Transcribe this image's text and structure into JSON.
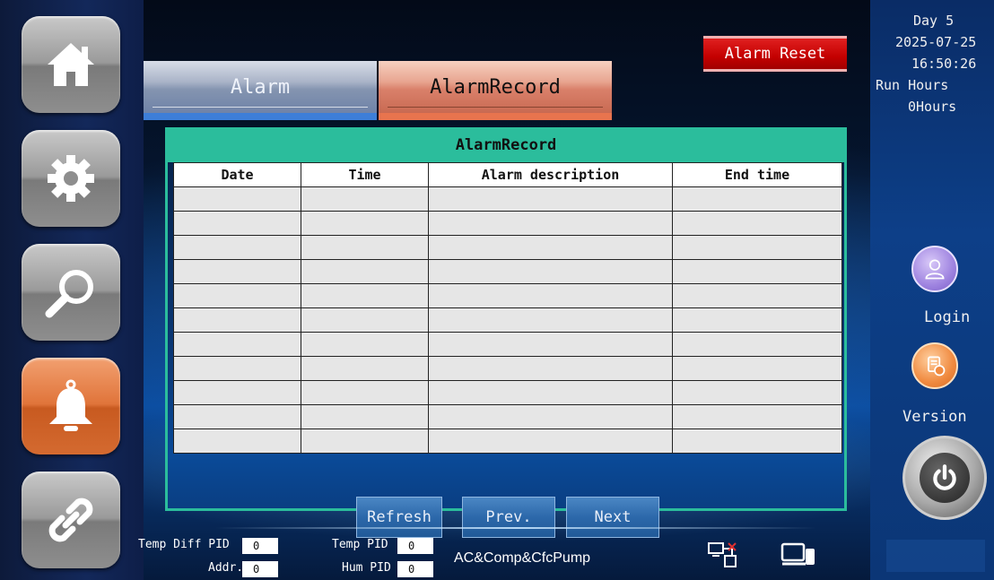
{
  "tabs": {
    "alarm": "Alarm",
    "alarm_record": "AlarmRecord"
  },
  "alarm_reset_label": "Alarm Reset",
  "status": {
    "day": "Day  5",
    "date": "2025-07-25",
    "time": "16:50:26",
    "run_hours_label": "Run Hours",
    "run_hours_value": "0Hours"
  },
  "right_menu": {
    "login_label": "Login",
    "version_label": "Version"
  },
  "record": {
    "title": "AlarmRecord",
    "columns": [
      "Date",
      "Time",
      "Alarm description",
      "End time"
    ],
    "rows": [
      [
        "",
        "",
        "",
        ""
      ],
      [
        "",
        "",
        "",
        ""
      ],
      [
        "",
        "",
        "",
        ""
      ],
      [
        "",
        "",
        "",
        ""
      ],
      [
        "",
        "",
        "",
        ""
      ],
      [
        "",
        "",
        "",
        ""
      ],
      [
        "",
        "",
        "",
        ""
      ],
      [
        "",
        "",
        "",
        ""
      ],
      [
        "",
        "",
        "",
        ""
      ],
      [
        "",
        "",
        "",
        ""
      ],
      [
        "",
        "",
        "",
        ""
      ]
    ],
    "buttons": {
      "refresh": "Refresh",
      "prev": "Prev.",
      "next": "Next"
    }
  },
  "bottom": {
    "temp_diff_pid_label": "Temp Diff PID",
    "temp_diff_pid_value": "0",
    "addr_label": "Addr.",
    "addr_value": "0",
    "temp_pid_label": "Temp PID",
    "temp_pid_value": "0",
    "hum_pid_label": "Hum PID",
    "hum_pid_value": "0",
    "mode_text": "AC&Comp&CfcPump"
  },
  "nav_icons": [
    "home-icon",
    "gear-icon",
    "search-icon",
    "bell-icon",
    "link-icon"
  ],
  "colors": {
    "accent_teal": "#2bbd9c",
    "active_orange": "#e0743a",
    "alarm_red": "#c40000"
  }
}
